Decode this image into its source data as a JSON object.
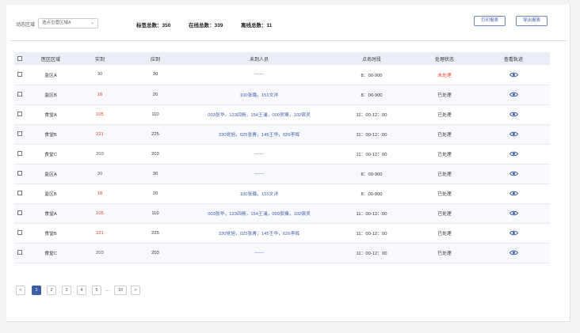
{
  "filter": {
    "label": "动态区域",
    "selected": "选点位管区域A"
  },
  "stats": [
    {
      "text": "标签总数：350"
    },
    {
      "text": "在线总数：339"
    },
    {
      "text": "离线总数：11"
    }
  ],
  "actions": {
    "print_label": "打印报表",
    "export_label": "导出报表"
  },
  "table": {
    "columns": [
      "医区区域",
      "实到",
      "应到",
      "未到人员",
      "点名时段",
      "处理状态",
      "查看轨迹"
    ],
    "rows": [
      {
        "area": "监区A",
        "actual": "30",
        "expected": "30",
        "absent": "------",
        "period": "8：00-900",
        "status": "未处理",
        "actual_alert": false,
        "status_pending": true
      },
      {
        "area": "监区B",
        "actual": "18",
        "expected": "20",
        "absent": "100张璐，151文洋",
        "period": "8：00-900",
        "status": "已处理",
        "actual_alert": true,
        "status_pending": false
      },
      {
        "area": "食堂A",
        "actual": "105",
        "expected": "110",
        "absent": "003张华，123四杨，154王浦，009贺揍，102宿灵",
        "period": "11：00-12：00",
        "status": "已处理",
        "actual_alert": true,
        "status_pending": false
      },
      {
        "area": "食堂B",
        "actual": "221",
        "expected": "225",
        "absent": "330党旭，025张青，145王华，026李辉",
        "period": "11：00-12：00",
        "status": "已处理",
        "actual_alert": true,
        "status_pending": false
      },
      {
        "area": "食堂C",
        "actual": "203",
        "expected": "203",
        "absent": "------",
        "period": "11：00-12：00",
        "status": "已处理",
        "actual_alert": false,
        "status_pending": false
      },
      {
        "area": "监区A",
        "actual": "30",
        "expected": "30",
        "absent": "------",
        "period": "8：00-900",
        "status": "已处理",
        "actual_alert": false,
        "status_pending": false
      },
      {
        "area": "监区B",
        "actual": "18",
        "expected": "20",
        "absent": "100张璐，151文洋",
        "period": "8：00-900",
        "status": "已处理",
        "actual_alert": true,
        "status_pending": false
      },
      {
        "area": "食堂A",
        "actual": "105",
        "expected": "110",
        "absent": "003张华，123四杨，154王浦，009贺揍，102宿灵",
        "period": "11：00-12：00",
        "status": "已处理",
        "actual_alert": true,
        "status_pending": false
      },
      {
        "area": "食堂B",
        "actual": "221",
        "expected": "225",
        "absent": "330党旭，025张青，145王华，026李辉",
        "period": "11：00-12：00",
        "status": "已处理",
        "actual_alert": true,
        "status_pending": false
      },
      {
        "area": "食堂C",
        "actual": "203",
        "expected": "203",
        "absent": "------",
        "period": "11：00-12：00",
        "status": "已处理",
        "actual_alert": false,
        "status_pending": false
      }
    ],
    "track_icon": "eye-icon"
  },
  "pagination": {
    "prev": "<",
    "next": ">",
    "pages": [
      "1",
      "2",
      "3",
      "4",
      "5"
    ],
    "ellipsis": "...",
    "last": "10",
    "current": "1"
  },
  "colors": {
    "accent": "#3d5fa8",
    "alert": "#e8402b",
    "header_bg": "#e9eef7"
  }
}
